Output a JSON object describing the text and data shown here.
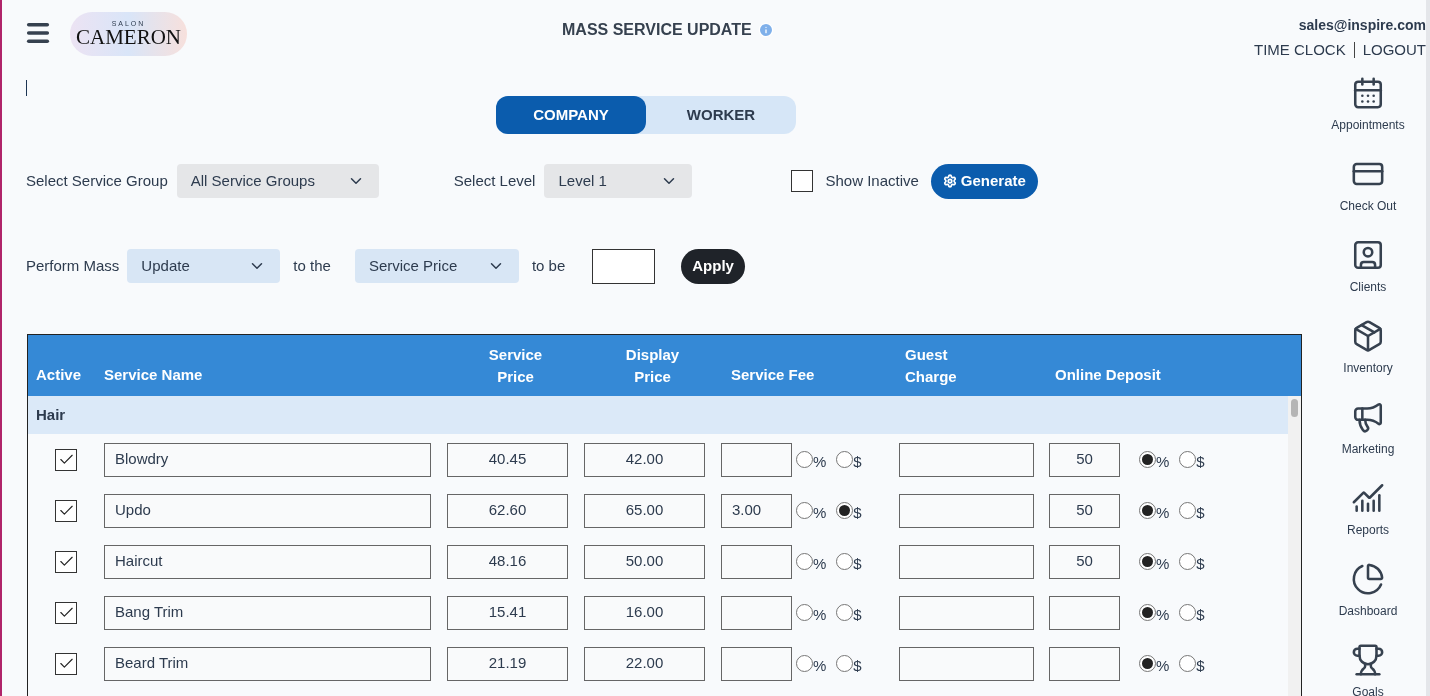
{
  "header": {
    "logo": {
      "small": "SALON",
      "big": "CAMERON"
    },
    "title": "MASS SERVICE UPDATE",
    "user_email": "sales@inspire.com",
    "links": [
      "TIME CLOCK",
      "LOGOUT"
    ]
  },
  "mode_tabs": [
    {
      "label": "COMPANY",
      "selected": true
    },
    {
      "label": "WORKER",
      "selected": false
    }
  ],
  "filters": {
    "service_group_label": "Select Service Group",
    "service_group_value": "All Service Groups",
    "level_label": "Select Level",
    "level_value": "Level 1",
    "show_inactive_label": "Show Inactive",
    "show_inactive_checked": false,
    "generate_button": "Generate"
  },
  "mass_update": {
    "label": "Perform Mass",
    "action_value": "Update",
    "to_the": "to the",
    "field_value": "Service Price",
    "to_be": "to be",
    "apply_button": "Apply"
  },
  "table": {
    "columns": [
      "Active",
      "Service Name",
      "Service Price",
      "Display Price",
      "Service Fee",
      "Guest Charge",
      "Online Deposit"
    ],
    "group": "Hair",
    "rows": [
      {
        "active": true,
        "name": "Blowdry",
        "service_price": "40.45",
        "display_price": "42.00",
        "service_fee": "",
        "fee_options": [
          {
            "label": "%",
            "selected": false
          },
          {
            "label": "$",
            "selected": false
          }
        ],
        "guest_charge": "",
        "online_deposit": "50",
        "deposit_options": [
          {
            "label": "%",
            "selected": true
          },
          {
            "label": "$",
            "selected": false
          }
        ]
      },
      {
        "active": true,
        "name": "Updo",
        "service_price": "62.60",
        "display_price": "65.00",
        "service_fee": "3.00",
        "fee_options": [
          {
            "label": "%",
            "selected": false
          },
          {
            "label": "$",
            "selected": true
          }
        ],
        "guest_charge": "",
        "online_deposit": "50",
        "deposit_options": [
          {
            "label": "%",
            "selected": true
          },
          {
            "label": "$",
            "selected": false
          }
        ]
      },
      {
        "active": true,
        "name": "Haircut",
        "service_price": "48.16",
        "display_price": "50.00",
        "service_fee": "",
        "fee_options": [
          {
            "label": "%",
            "selected": false
          },
          {
            "label": "$",
            "selected": false
          }
        ],
        "guest_charge": "",
        "online_deposit": "50",
        "deposit_options": [
          {
            "label": "%",
            "selected": true
          },
          {
            "label": "$",
            "selected": false
          }
        ]
      },
      {
        "active": true,
        "name": "Bang Trim",
        "service_price": "15.41",
        "display_price": "16.00",
        "service_fee": "",
        "fee_options": [
          {
            "label": "%",
            "selected": false
          },
          {
            "label": "$",
            "selected": false
          }
        ],
        "guest_charge": "",
        "online_deposit": "",
        "deposit_options": [
          {
            "label": "%",
            "selected": true
          },
          {
            "label": "$",
            "selected": false
          }
        ]
      },
      {
        "active": true,
        "name": "Beard Trim",
        "service_price": "21.19",
        "display_price": "22.00",
        "service_fee": "",
        "fee_options": [
          {
            "label": "%",
            "selected": false
          },
          {
            "label": "$",
            "selected": false
          }
        ],
        "guest_charge": "",
        "online_deposit": "",
        "deposit_options": [
          {
            "label": "%",
            "selected": true
          },
          {
            "label": "$",
            "selected": false
          }
        ]
      }
    ]
  },
  "sidebar": {
    "items": [
      {
        "label": "Appointments"
      },
      {
        "label": "Check Out"
      },
      {
        "label": "Clients"
      },
      {
        "label": "Inventory"
      },
      {
        "label": "Marketing"
      },
      {
        "label": "Reports"
      },
      {
        "label": "Dashboard"
      },
      {
        "label": "Goals"
      }
    ]
  }
}
